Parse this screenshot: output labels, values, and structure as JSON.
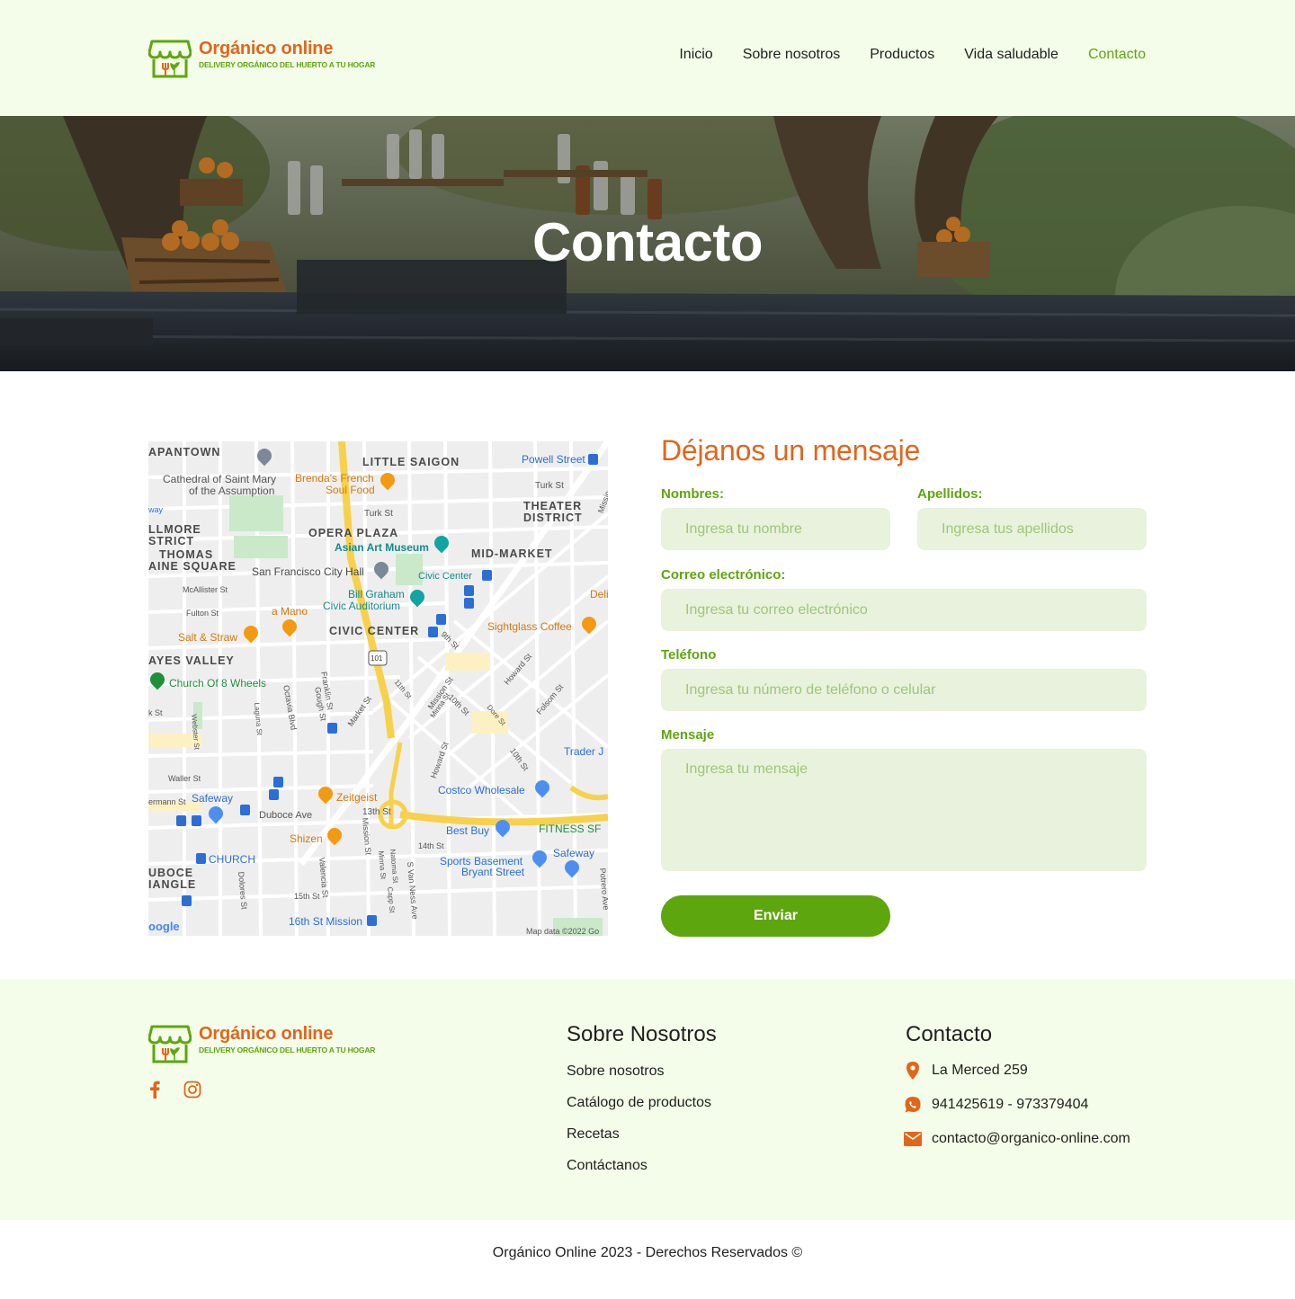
{
  "brand": {
    "name": "Orgánico online",
    "tagline": "DELIVERY ORGÁNICO DEL HUERTO A TU HOGAR",
    "orange": "#e2651c",
    "green": "#5ea60d"
  },
  "nav": {
    "items": [
      {
        "label": "Inicio",
        "active": false
      },
      {
        "label": "Sobre nosotros",
        "active": false
      },
      {
        "label": "Productos",
        "active": false
      },
      {
        "label": "Vida saludable",
        "active": false
      },
      {
        "label": "Contacto",
        "active": true
      }
    ]
  },
  "hero": {
    "title": "Contacto"
  },
  "map": {
    "labels": {
      "chinatown": "APANTOWN",
      "little_saigon": "LITTLE SAIGON",
      "cathedral": "Cathedral of Saint Mary",
      "cathedral2": "of the Assumption",
      "brendas": "Brenda's French",
      "brendas2": "Soul Food",
      "powell": "Powell Street",
      "turk1": "Turk St",
      "turk2": "Turk St",
      "theater": "THEATER",
      "theater2": "DISTRICT",
      "fillmore": "LLMORE",
      "fillmore2": "STRICT",
      "thomas": "THOMAS",
      "paine": "AINE SQUARE",
      "opera": "OPERA PLAZA",
      "asian": "Asian Art Museum",
      "midmarket": "MID-MARKET",
      "cityhall": "San Francisco City Hall",
      "civiccenter_st": "Civic Center",
      "mcallister": "McAllister St",
      "billgraham": "Bill Graham",
      "billgraham2": "Civic Auditorium",
      "fulton": "Fulton St",
      "amano": "a Mano",
      "civic": "CIVIC CENTER",
      "sightglass": "Sightglass Coffee",
      "salt": "Salt & Straw",
      "hayes": "AYES VALLEY",
      "church8": "Church Of 8 Wheels",
      "franklin": "Franklin St",
      "octavia": "Octavia Blvd",
      "gough": "Gough St",
      "market": "Market St",
      "mission": "Mission St",
      "tenth": "10th St",
      "ninth": "9th St",
      "howard": "Howard St",
      "folsom": "Folsom St",
      "eleventh": "11th St",
      "minna": "Minna St",
      "dore": "Dore St",
      "webster": "Webster St",
      "laguna": "Laguna St",
      "oak": "k St",
      "waller": "Waller St",
      "trader": "Trader J",
      "howard2": "Howard St",
      "tenth2": "10th St",
      "costco": "Costco Wholesale",
      "safeway": "Safeway",
      "hermann": "ermann St",
      "zeitgeist": "Zeitgeist",
      "duboce": "Duboce Ave",
      "thirteenth": "13th St",
      "bestbuy": "Best Buy",
      "fitness": "FITNESS SF",
      "shizen": "Shizen",
      "fourteenth": "14th St",
      "church": "CHURCH",
      "safeway2": "Safeway",
      "sports": "Sports Basement",
      "sports2": "Bryant Street",
      "duboce_tri": "UBOCE",
      "duboce_tri2": "IANGLE",
      "dolores": "Dolores St",
      "valencia": "Valencia St",
      "mission2": "Mission St",
      "natoma": "Natoma St",
      "minna2": "Minna St",
      "capp": "Capp St",
      "vanness": "S Van Ness Ave",
      "potrero": "Potrero Ave",
      "fifteenth": "15th St",
      "sixteenth": "16th St Mission",
      "google": "oogle",
      "mapdata": "Map data ©2022 Go",
      "deli": "Deli B",
      "missionsig": "Missio",
      "way": "way",
      "route101": "101"
    }
  },
  "form": {
    "title": "Déjanos un mensaje",
    "fields": {
      "nombres": {
        "label": "Nombres:",
        "placeholder": "Ingresa tu nombre"
      },
      "apellidos": {
        "label": "Apellidos:",
        "placeholder": "Ingresa tus apellidos"
      },
      "correo": {
        "label": "Correo electrónico:",
        "placeholder": "Ingresa tu correo electrónico"
      },
      "telefono": {
        "label": "Teléfono",
        "placeholder": "Ingresa tu número de teléfono o celular"
      },
      "mensaje": {
        "label": "Mensaje",
        "placeholder": "Ingresa tu mensaje"
      }
    },
    "submit": "Enviar"
  },
  "footer": {
    "social": [
      "facebook-icon",
      "instagram-icon"
    ],
    "about": {
      "title": "Sobre Nosotros",
      "links": [
        "Sobre nosotros",
        "Catálogo de productos",
        "Recetas",
        "Contáctanos"
      ]
    },
    "contact": {
      "title": "Contacto",
      "address": "La Merced 259",
      "phones": "941425619 - 973379404",
      "email": "contacto@organico-online.com"
    },
    "copyright": "Orgánico Online 2023 - Derechos Reservados ©"
  }
}
